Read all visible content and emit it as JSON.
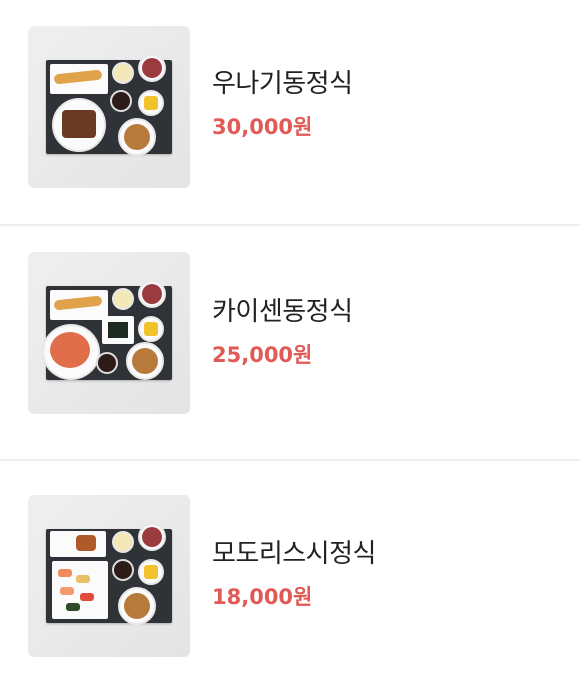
{
  "menu": {
    "items": [
      {
        "name": "우나기동정식",
        "price": "30,000원",
        "image": "unagidon-set-tray-photo"
      },
      {
        "name": "카이센동정식",
        "price": "25,000원",
        "image": "kaisendon-set-tray-photo"
      },
      {
        "name": "모도리스시정식",
        "price": "18,000원",
        "image": "modori-sushi-set-tray-photo"
      }
    ]
  },
  "colors": {
    "price": "#e05a56",
    "name": "#222222",
    "divider": "#eeeeee",
    "tray": "#2f3236"
  }
}
